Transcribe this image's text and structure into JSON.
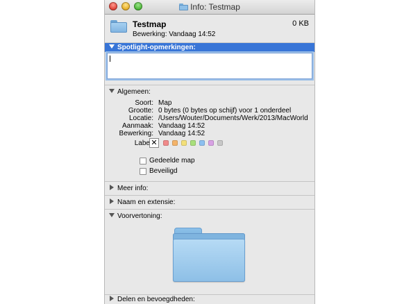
{
  "window": {
    "title": "Info: Testmap"
  },
  "header": {
    "name": "Testmap",
    "modified": "Bewerking:  Vandaag 14:52",
    "size": "0 KB"
  },
  "spotlight": {
    "label": "Spotlight-opmerkingen:",
    "value": ""
  },
  "general": {
    "label": "Algemeen:",
    "rows": [
      {
        "key": "Soort:",
        "value": "Map"
      },
      {
        "key": "Grootte:",
        "value": "0 bytes (0 bytes op schijf) voor 1 onderdeel"
      },
      {
        "key": "Locatie:",
        "value": "/Users/Wouter/Documents/Werk/2013/MacWorld"
      },
      {
        "key": "Aanmaak:",
        "value": "Vandaag 14:52"
      },
      {
        "key": "Bewerking:",
        "value": "Vandaag 14:52"
      }
    ],
    "label_key": "Label:",
    "label_none_icon": "x-icon",
    "label_colors": [
      "#f08a8a",
      "#f4b46a",
      "#f3e07a",
      "#a9e07c",
      "#8dc0f0",
      "#d8a2e4",
      "#c8c8c8"
    ],
    "shared_folder": {
      "label": "Gedeelde map",
      "checked": false
    },
    "locked": {
      "label": "Beveiligd",
      "checked": false
    }
  },
  "sections": {
    "more_info": "Meer info:",
    "name_extension": "Naam en extensie:",
    "preview": "Voorvertoning:",
    "sharing": "Delen en bevoegdheden:"
  },
  "colors": {
    "selected_section": "#3875d7",
    "window_bg": "#e8e8e8"
  }
}
